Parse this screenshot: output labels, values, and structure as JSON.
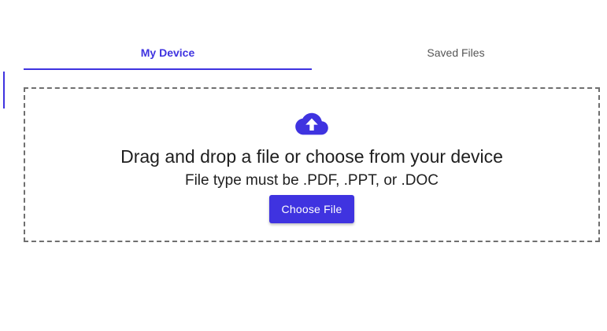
{
  "colors": {
    "accent": "#3f33e0",
    "text": "#1f1f1f",
    "tab_inactive": "#555555",
    "dashed_border": "#6f6f6f"
  },
  "tabs": [
    {
      "label": "My Device",
      "active": true
    },
    {
      "label": "Saved Files",
      "active": false
    }
  ],
  "dropzone": {
    "icon": "cloud-upload-icon",
    "heading": "Drag and drop a file or choose from your device",
    "subheading": "File type must be .PDF, .PPT, or .DOC",
    "button_label": "Choose File"
  }
}
